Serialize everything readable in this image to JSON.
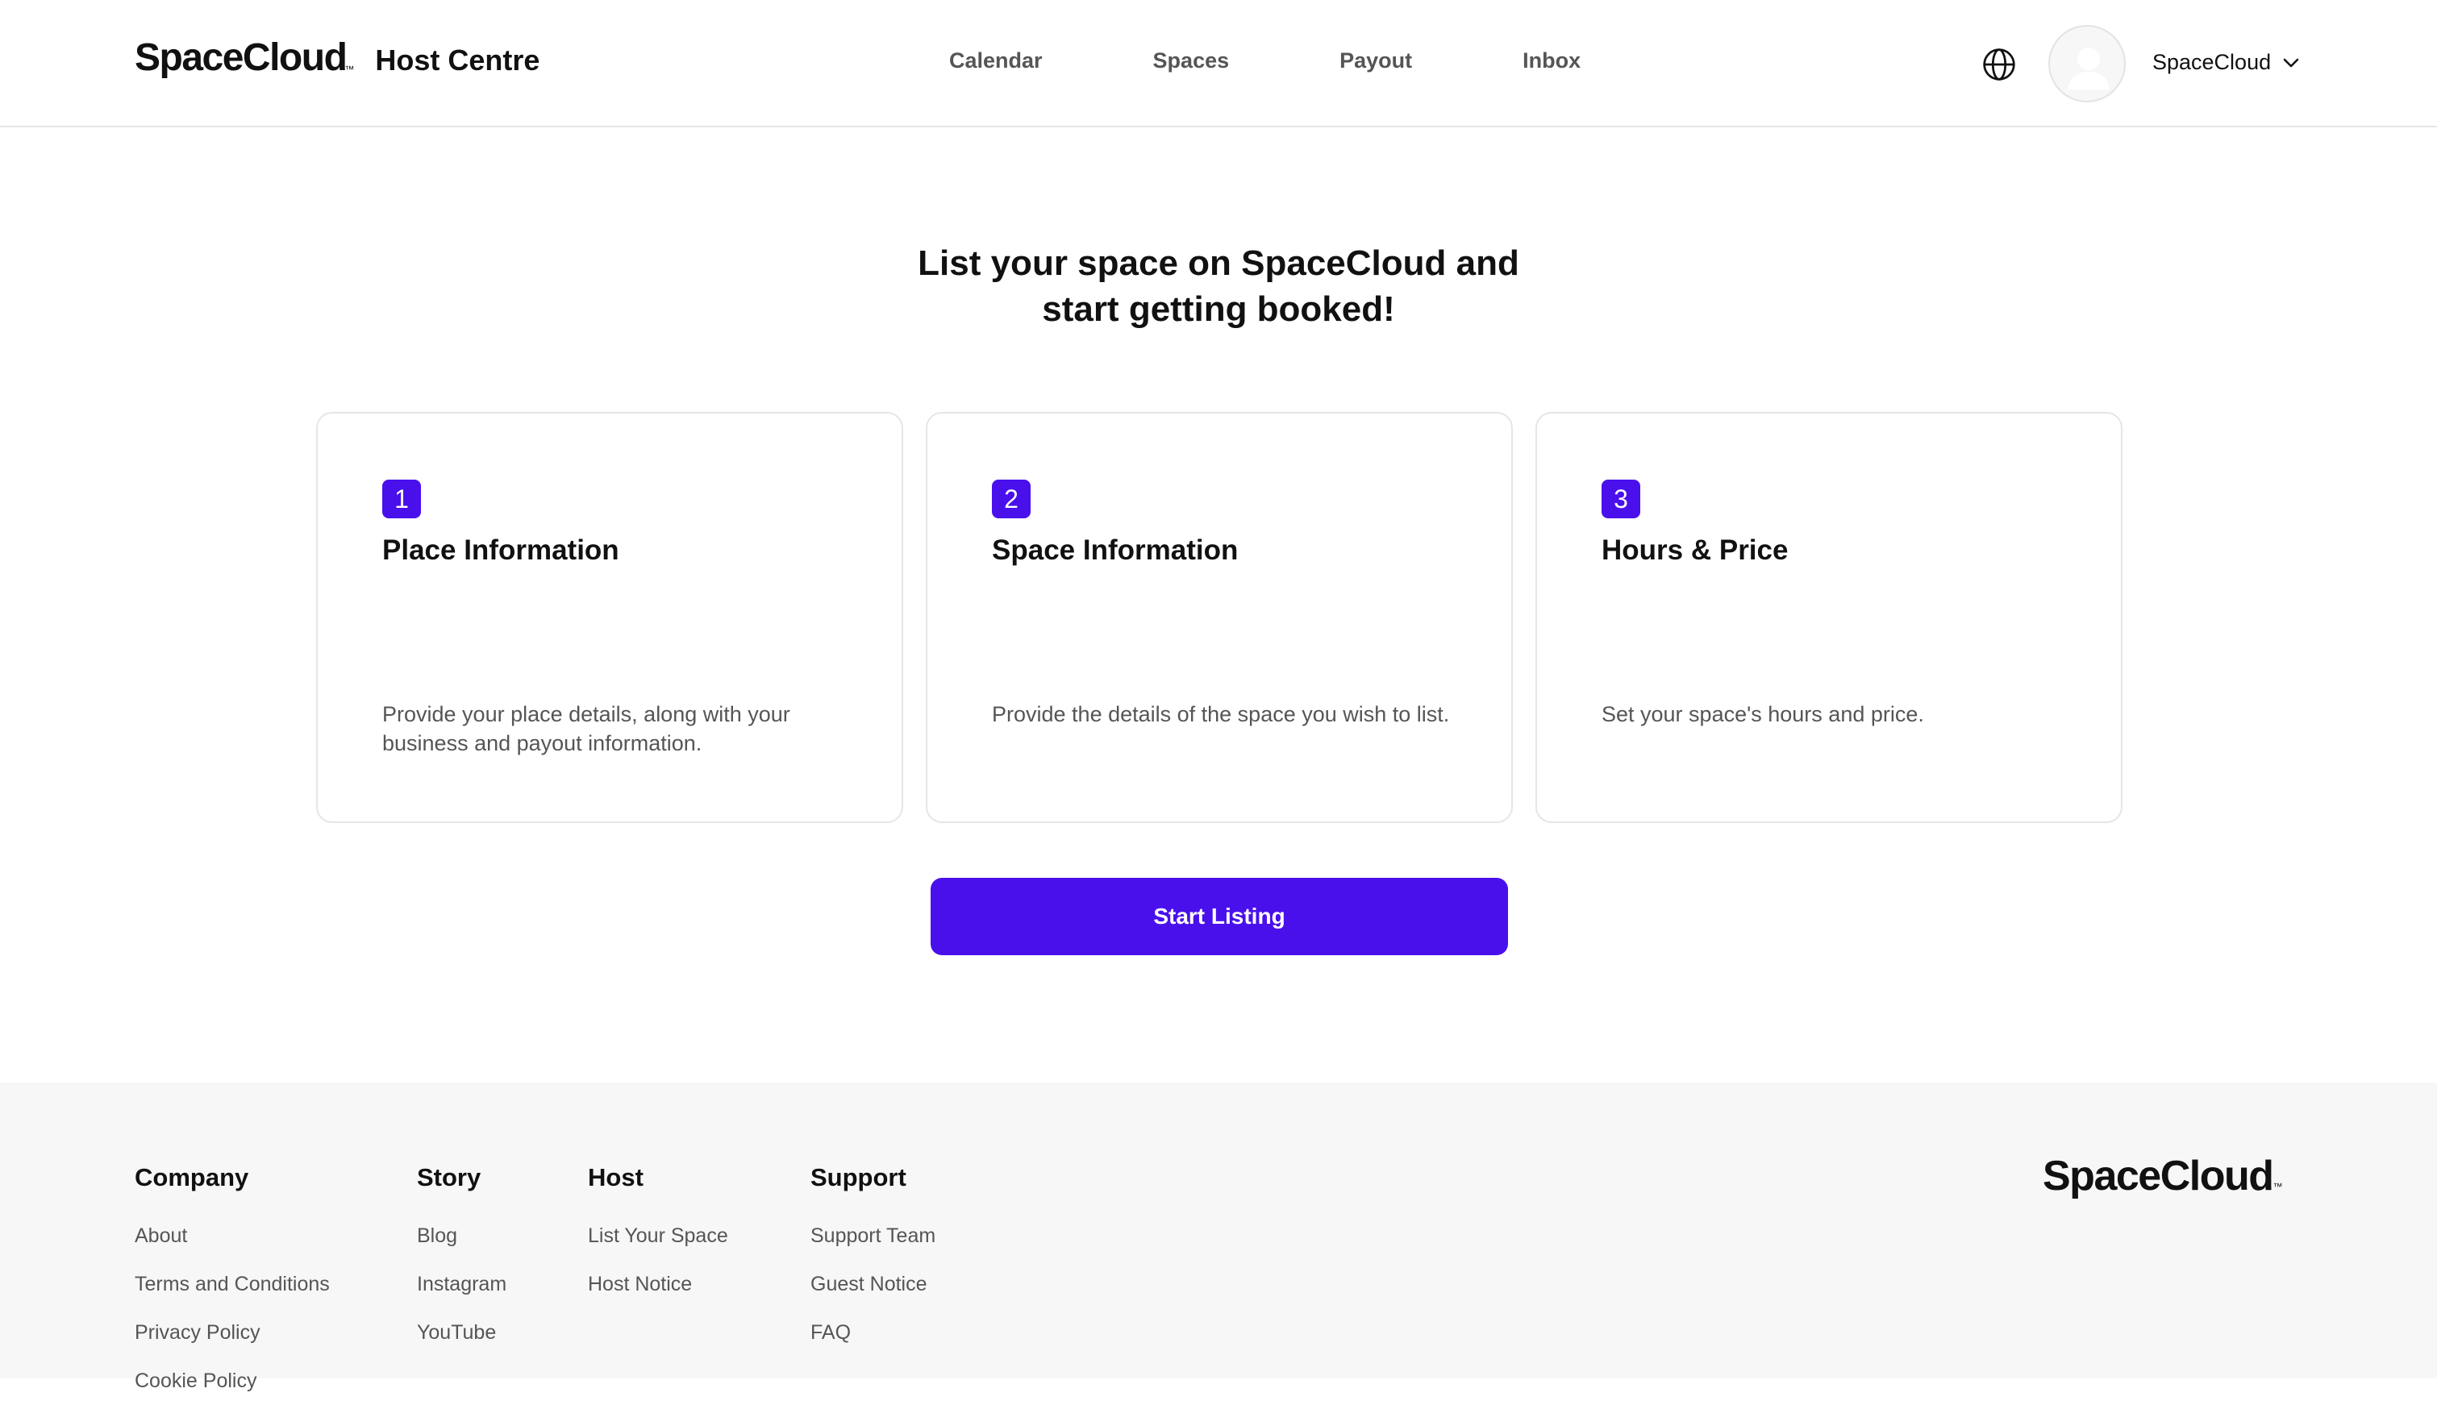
{
  "header": {
    "logo": "SpaceCloud",
    "logo_tm": "™",
    "section_title": "Host Centre",
    "nav": [
      "Calendar",
      "Spaces",
      "Payout",
      "Inbox"
    ],
    "icons": {
      "language": "globe-icon",
      "avatar": "user-avatar-icon",
      "menu": "chevron-down-icon"
    },
    "user_name": "SpaceCloud"
  },
  "main": {
    "headline_line1": "List your space on SpaceCloud and",
    "headline_line2": "start getting booked!",
    "steps": [
      {
        "number": "1",
        "title": "Place Information",
        "description": "Provide your place details, along with your business and payout information."
      },
      {
        "number": "2",
        "title": "Space Information",
        "description": "Provide the details of the space you wish to list."
      },
      {
        "number": "3",
        "title": "Hours & Price",
        "description": "Set your space's hours and price."
      }
    ],
    "cta_label": "Start Listing"
  },
  "footer": {
    "columns": [
      {
        "title": "Company",
        "links": [
          "About",
          "Terms and Conditions",
          "Privacy Policy",
          "Cookie Policy"
        ]
      },
      {
        "title": "Story",
        "links": [
          "Blog",
          "Instagram",
          "YouTube"
        ]
      },
      {
        "title": "Host",
        "links": [
          "List Your Space",
          "Host Notice"
        ]
      },
      {
        "title": "Support",
        "links": [
          "Support Team",
          "Guest Notice",
          "FAQ"
        ]
      }
    ],
    "logo": "SpaceCloud",
    "logo_tm": "™"
  },
  "colors": {
    "accent": "#4a10ec",
    "text": "#111111",
    "muted_text": "#555555",
    "border": "#e6e6e6",
    "footer_bg": "#f7f7f7"
  }
}
